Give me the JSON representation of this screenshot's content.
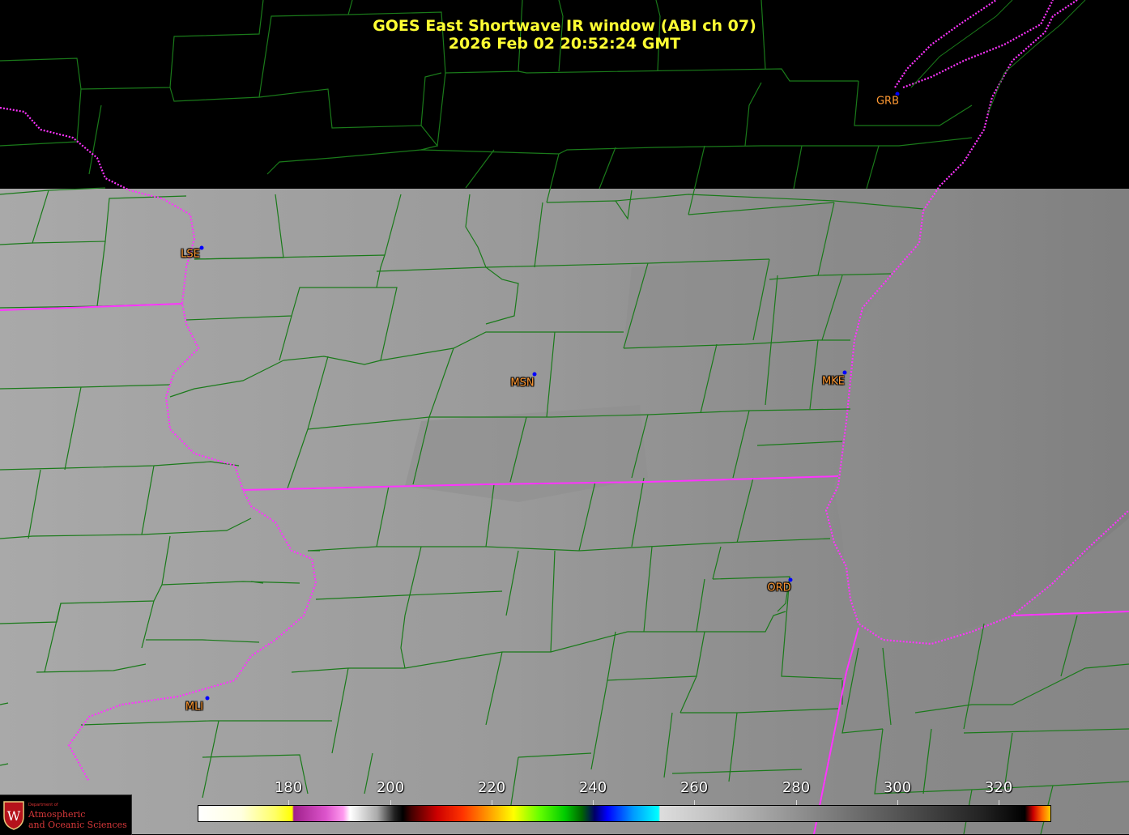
{
  "title": {
    "line1": "GOES East Shortwave IR window (ABI ch 07)",
    "line2": "2026 Feb 02  20:52:24 GMT"
  },
  "stations": [
    {
      "code": "GRB"
    },
    {
      "code": "LSE"
    },
    {
      "code": "MSN"
    },
    {
      "code": "MKE"
    },
    {
      "code": "ORD"
    },
    {
      "code": "MLI"
    }
  ],
  "colorbar": {
    "ticks": [
      "180",
      "200",
      "220",
      "240",
      "260",
      "280",
      "300",
      "320"
    ]
  },
  "logo": {
    "dept": "Department of",
    "line1": "Atmospheric",
    "line2": "and Oceanic Sciences",
    "letter": "W"
  },
  "colors": {
    "title": "#ffff33",
    "station_label": "#ff9933",
    "station_dot": "#0000ff",
    "county_lines": "#1a7a1a",
    "state_lines": "#ff33ff",
    "no_data": "#000000"
  }
}
